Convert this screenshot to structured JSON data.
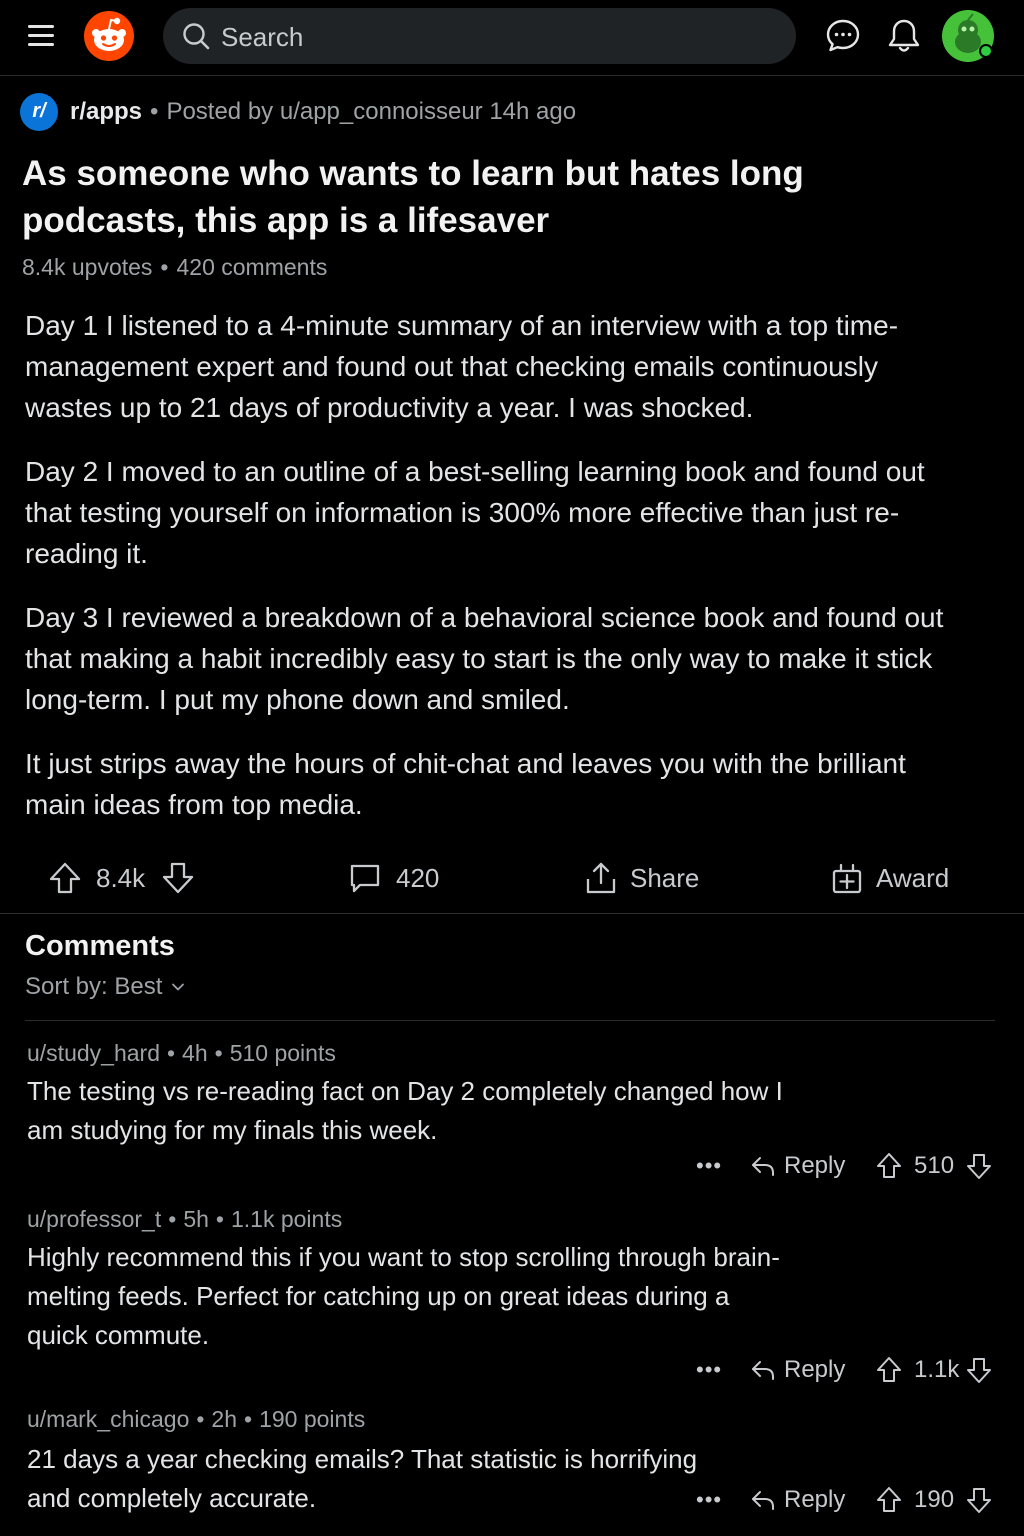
{
  "header": {
    "search_placeholder": "Search",
    "accent_color": "#ff4500"
  },
  "post": {
    "subreddit": "r/apps",
    "subreddit_icon_text": "r/",
    "posted_by": "Posted by u/app_connoisseur",
    "time": "14h ago",
    "title": "As someone who wants to learn but hates long podcasts, this app is a lifesaver",
    "upvotes_text": "8.4k upvotes",
    "comments_text": "420 comments",
    "body": [
      "Day 1 I listened to a 4-minute summary of an interview with a top time-management expert and found out that checking emails continuously wastes up to 21 days of productivity a year. I was shocked.",
      "Day 2 I moved to an outline of a best-selling learning book and found out that testing yourself on information is 300% more effective than just re-reading it.",
      "Day 3 I reviewed a breakdown of a behavioral science book and found out that making a habit incredibly easy to start is the only way to make it stick long-term. I put my phone down and smiled.",
      "It just strips away the hours of chit-chat and leaves you with the brilliant main ideas from top media."
    ],
    "actions": {
      "votes": "8.4k",
      "comments": "420",
      "share": "Share",
      "award": "Award"
    }
  },
  "comments_section": {
    "heading": "Comments",
    "sort_label": "Sort by: Best",
    "items": [
      {
        "user": "u/study_hard",
        "time": "4h",
        "points": "510 points",
        "text": "The testing vs re-reading fact on Day 2 completely changed how I am studying for my finals this week.",
        "more": "•••",
        "reply": "Reply",
        "votes": "510"
      },
      {
        "user": "u/professor_t",
        "time": "5h",
        "points": "1.1k points",
        "text": "Highly recommend this if you want to stop scrolling through brain-melting feeds. Perfect for catching up on great ideas during a quick commute.",
        "more": "•••",
        "reply": "Reply",
        "votes": "1.1k"
      },
      {
        "user": "u/mark_chicago",
        "time": "2h",
        "points": "190 points",
        "text": "21 days a year checking emails? That statistic is horrifying and completely accurate.",
        "more": "•••",
        "reply": "Reply",
        "votes": "190"
      }
    ]
  }
}
